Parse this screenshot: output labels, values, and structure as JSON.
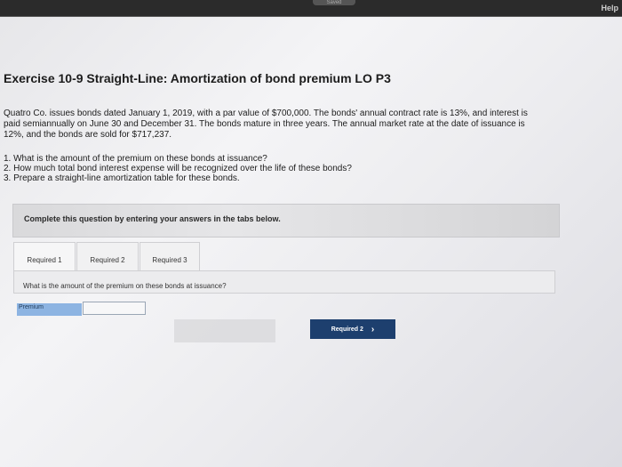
{
  "header": {
    "saved_label": "Saved",
    "help_label": "Help"
  },
  "exercise": {
    "title": "Exercise 10-9 Straight-Line: Amortization of bond premium LO P3",
    "intro_line1": "Quatro Co. issues bonds dated January 1, 2019, with a par value of $700,000. The bonds' annual contract rate is 13%, and interest is",
    "intro_line2": "paid semiannually on June 30 and December 31. The bonds mature in three years. The annual market rate at the date of issuance is",
    "intro_line3": "12%, and the bonds are sold for $717,237.",
    "questions": [
      "1. What is the amount of the premium on these bonds at issuance?",
      "2. How much total bond interest expense will be recognized over the life of these bonds?",
      "3. Prepare a straight-line amortization table for these bonds."
    ]
  },
  "instructions": {
    "text": "Complete this question by entering your answers in the tabs below."
  },
  "tabs": [
    {
      "label": "Required 1",
      "active": true
    },
    {
      "label": "Required 2",
      "active": false
    },
    {
      "label": "Required 3",
      "active": false
    }
  ],
  "required1": {
    "question": "What is the amount of the premium on these bonds at issuance?",
    "premium_label": "Premium",
    "premium_value": ""
  },
  "navigation": {
    "next_label": "Required 2",
    "next_icon": "chevron-right-icon"
  },
  "colors": {
    "topbar": "#2b2b2b",
    "premium_label_bg": "#8db4e2",
    "next_button_bg": "#1d3f6e"
  }
}
